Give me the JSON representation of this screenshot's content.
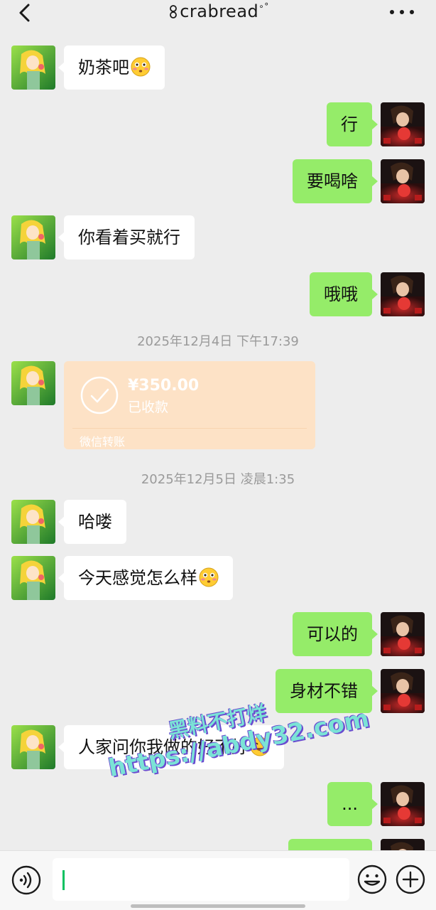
{
  "header": {
    "title": "crabread",
    "back_icon": "chevron-left-icon",
    "more_icon": "more-dots-icon"
  },
  "messages": [
    {
      "side": "in",
      "text": "奶茶吧",
      "emoji": "flushed-face-emoji"
    },
    {
      "side": "out",
      "text": "行"
    },
    {
      "side": "out",
      "text": "要喝啥"
    },
    {
      "side": "in",
      "text": "你看着买就行"
    },
    {
      "side": "out",
      "text": "哦哦"
    },
    {
      "side": "in",
      "text": "哈喽"
    },
    {
      "side": "in",
      "text": "今天感觉怎么样",
      "emoji": "flushed-face-emoji"
    },
    {
      "side": "out",
      "text": "可以的"
    },
    {
      "side": "out",
      "text": "身材不错"
    },
    {
      "side": "in",
      "text": "人家问你我做的好不好",
      "emoji": "grinning-face-emoji"
    },
    {
      "side": "out",
      "text": "..."
    }
  ],
  "timestamps": [
    "2025年12月4日 下午17:39",
    "2025年12月5日 凌晨1:35"
  ],
  "transfer": {
    "amount": "¥350.00",
    "status": "已收款",
    "label": "微信转账"
  },
  "watermark": {
    "line1": "黑料不打烊",
    "line2": "https://abdy32.com"
  },
  "input_bar": {
    "voice_icon": "voice-icon",
    "emoji_icon": "emoji-icon",
    "plus_icon": "plus-icon",
    "value": ""
  },
  "colors": {
    "background": "#ededed",
    "outgoing_bubble": "#95ec69",
    "incoming_bubble": "#ffffff",
    "transfer_card": "#fde2c6",
    "caret": "#07c160"
  }
}
